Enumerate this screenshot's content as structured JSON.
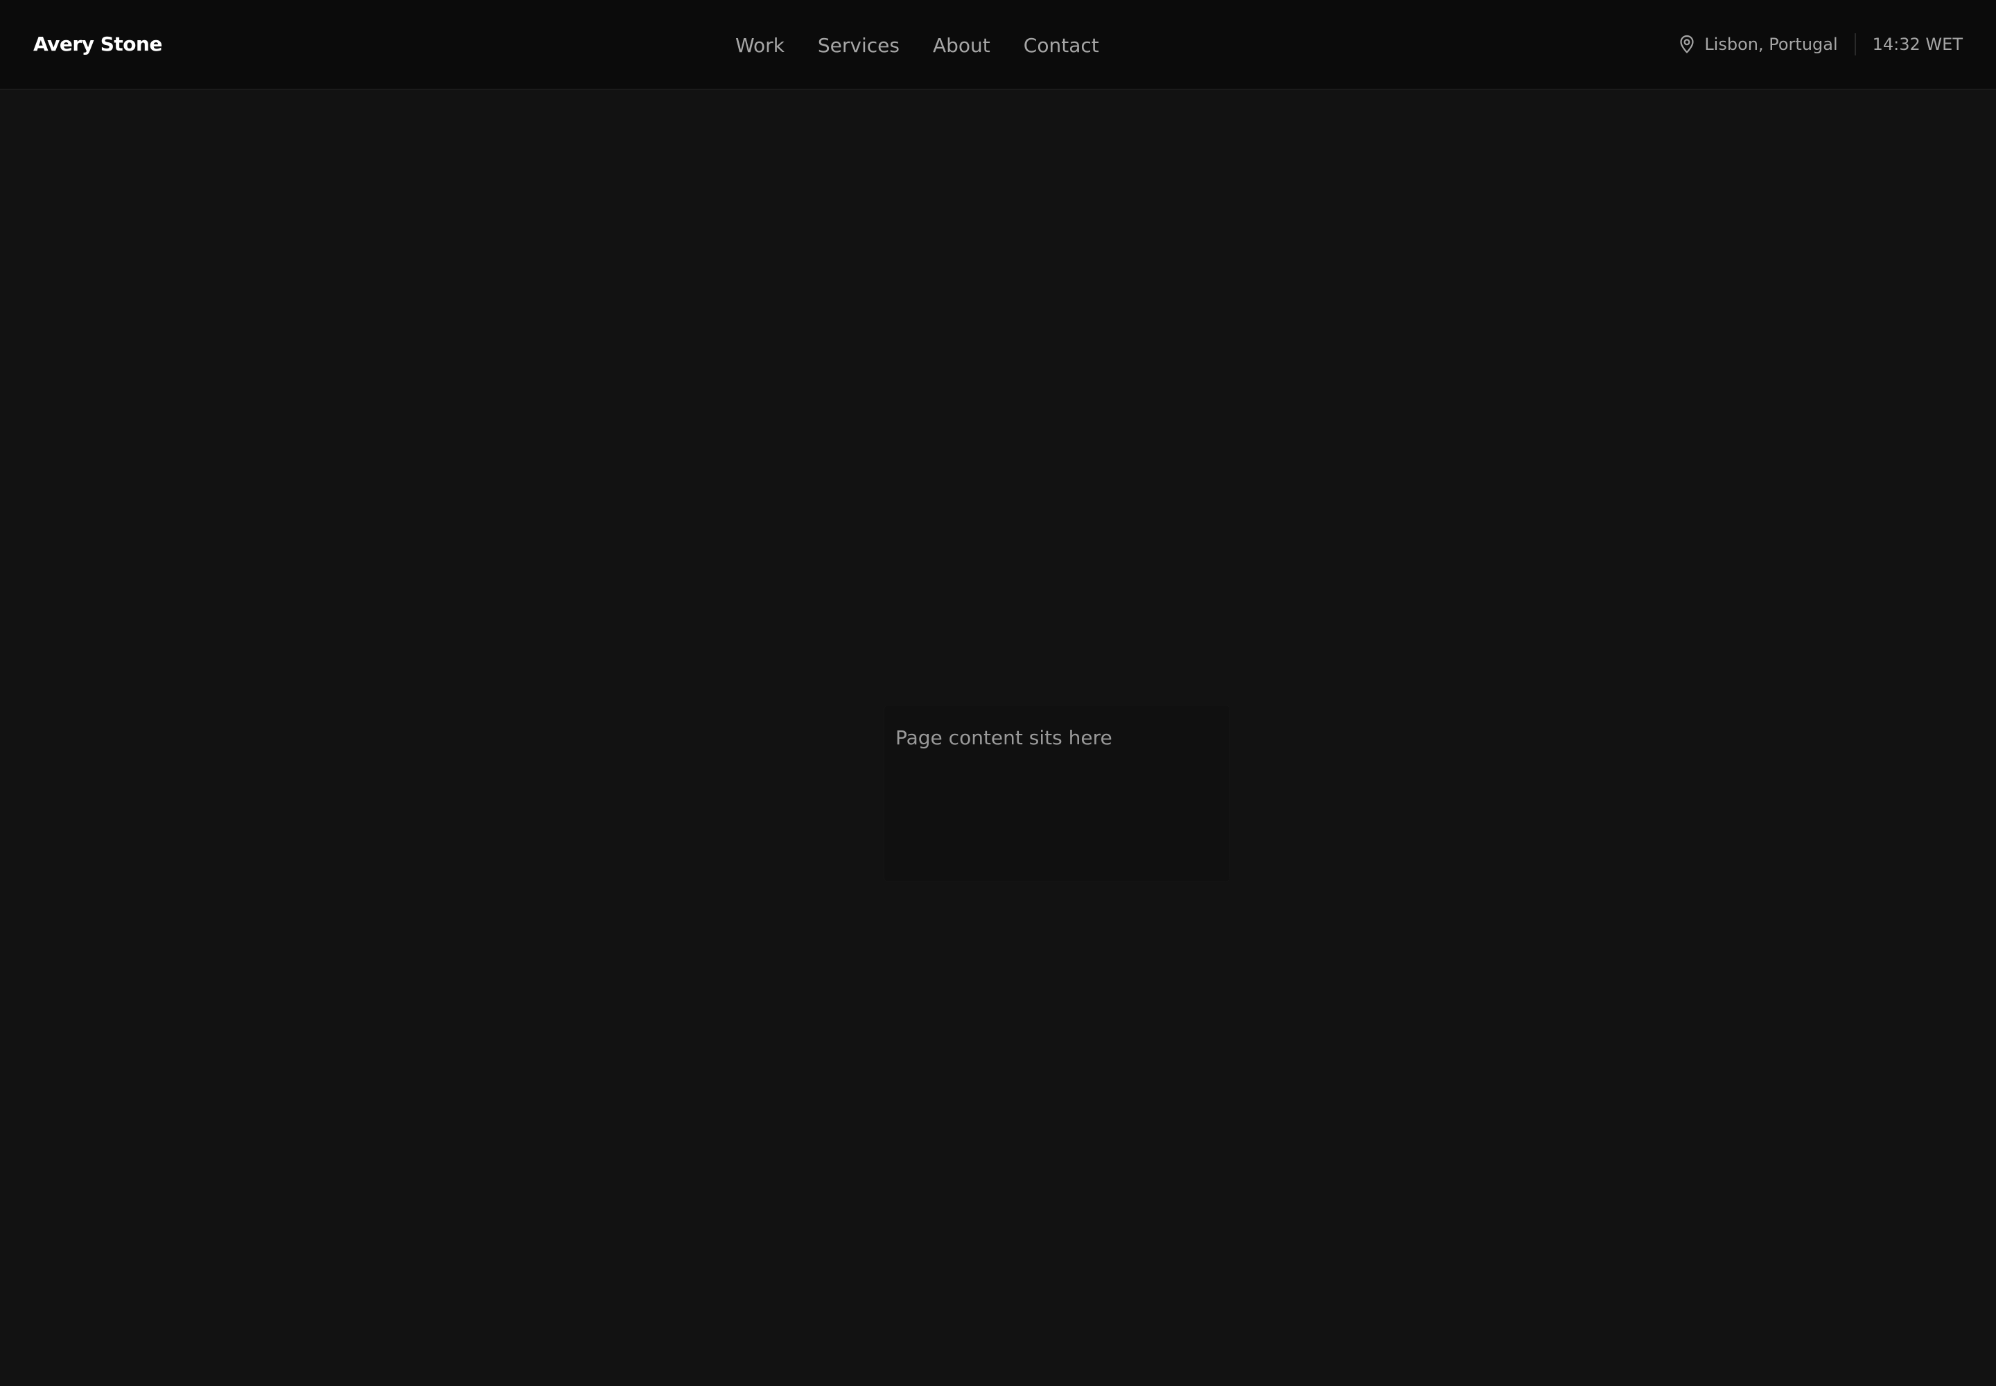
{
  "header": {
    "brand": "Avery Stone",
    "nav": [
      {
        "label": "Work"
      },
      {
        "label": "Services"
      },
      {
        "label": "About"
      },
      {
        "label": "Contact"
      }
    ],
    "location": "Lisbon, Portugal",
    "location_icon": "map-pin-icon",
    "time": "14:32 WET"
  },
  "main": {
    "placeholder_text": "Page content sits here"
  },
  "colors": {
    "background": "#121212",
    "topbar": "#0b0b0b",
    "brand_text": "#ffffff",
    "nav_text": "#a6a6a6"
  }
}
